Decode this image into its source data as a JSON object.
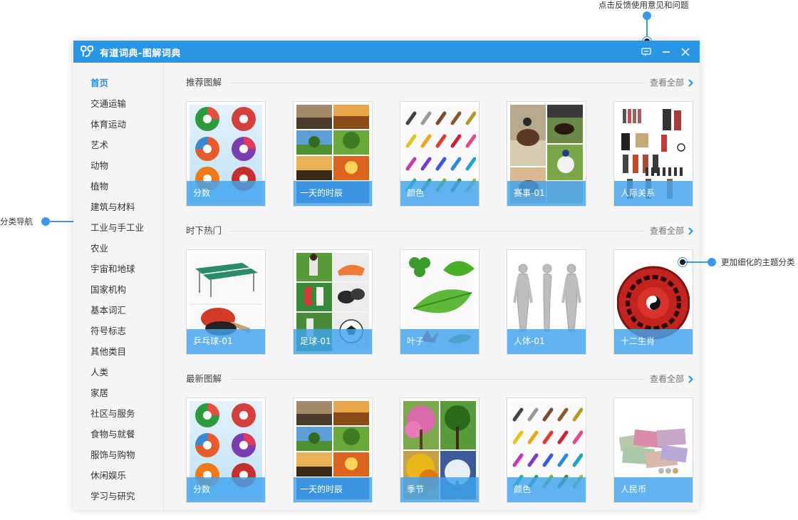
{
  "window": {
    "title": "有道词典-图解词典"
  },
  "sidebar": {
    "items": [
      {
        "label": "首页",
        "active": true
      },
      {
        "label": "交通运输"
      },
      {
        "label": "体育运动"
      },
      {
        "label": "艺术"
      },
      {
        "label": "动物"
      },
      {
        "label": "植物"
      },
      {
        "label": "建筑与材料"
      },
      {
        "label": "工业与手工业"
      },
      {
        "label": "农业"
      },
      {
        "label": "宇宙和地球"
      },
      {
        "label": "国家机构"
      },
      {
        "label": "基本词汇"
      },
      {
        "label": "符号标志"
      },
      {
        "label": "其他类目"
      },
      {
        "label": "人类"
      },
      {
        "label": "家居"
      },
      {
        "label": "社区与服务"
      },
      {
        "label": "食物与就餐"
      },
      {
        "label": "服饰与购物"
      },
      {
        "label": "休闲娱乐"
      },
      {
        "label": "学习与研究"
      }
    ]
  },
  "sections": [
    {
      "title": "推荐图解",
      "view_all": "查看全部",
      "cards": [
        {
          "label": "分数",
          "thumb": "fractions"
        },
        {
          "label": "一天的时辰",
          "thumb": "times-of-day"
        },
        {
          "label": "颜色",
          "thumb": "colored-pencils"
        },
        {
          "label": "赛事-01",
          "thumb": "equestrian"
        },
        {
          "label": "人际关系",
          "thumb": "people"
        }
      ]
    },
    {
      "title": "时下热门",
      "view_all": "查看全部",
      "cards": [
        {
          "label": "乒乓球-01",
          "thumb": "table-tennis"
        },
        {
          "label": "足球-01",
          "thumb": "soccer"
        },
        {
          "label": "叶子",
          "thumb": "leaves"
        },
        {
          "label": "人体-01",
          "thumb": "human-body"
        },
        {
          "label": "十二生肖",
          "thumb": "zodiac"
        }
      ]
    },
    {
      "title": "最新图解",
      "view_all": "查看全部",
      "cards": [
        {
          "label": "分数",
          "thumb": "fractions"
        },
        {
          "label": "一天的时辰",
          "thumb": "times-of-day"
        },
        {
          "label": "季节",
          "thumb": "seasons"
        },
        {
          "label": "颜色",
          "thumb": "colored-pencils"
        },
        {
          "label": "人民币",
          "thumb": "banknotes"
        }
      ]
    }
  ],
  "callouts": {
    "feedback": "点击反馈使用意见和问题",
    "nav": "分类导航",
    "topics": "更加细化的主题分类"
  },
  "colors": {
    "titlebar": "#2a95e5",
    "accent": "#2a8de0",
    "label_overlay": "#40a4ee",
    "callout": "#3a98e6"
  }
}
